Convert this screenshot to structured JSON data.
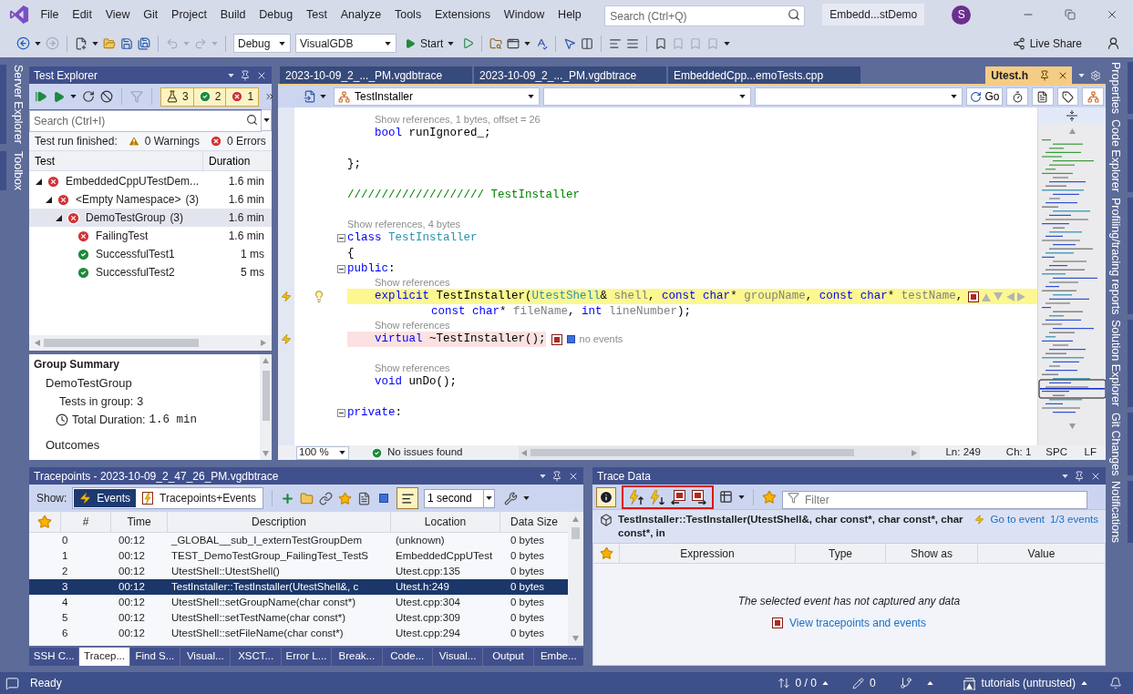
{
  "menu": {
    "items": [
      "File",
      "Edit",
      "View",
      "Git",
      "Project",
      "Build",
      "Debug",
      "Test",
      "Analyze",
      "Tools",
      "Extensions",
      "Window",
      "Help"
    ],
    "search": {
      "placeholder": "Search (Ctrl+Q)"
    },
    "solution": "Embedd...stDemo",
    "avatar": "S"
  },
  "toolbar": {
    "configuration": "Debug",
    "platform": "VisualGDB",
    "start": "Start",
    "live_share": "Live Share"
  },
  "left_dock": [
    {
      "label": "Server Explorer"
    },
    {
      "label": "Toolbox"
    }
  ],
  "right_dock": [
    {
      "label": "Properties"
    },
    {
      "label": "Code Explorer"
    },
    {
      "label": "Profiling/tracing reports"
    },
    {
      "label": "Solution Explorer"
    },
    {
      "label": "Git Changes"
    },
    {
      "label": "Notifications"
    }
  ],
  "test_explorer": {
    "title": "Test Explorer",
    "counters": [
      {
        "kind": "total",
        "count": "3"
      },
      {
        "kind": "passed",
        "count": "2"
      },
      {
        "kind": "failed",
        "count": "1"
      }
    ],
    "search": {
      "placeholder": "Search (Ctrl+I)"
    },
    "run_status": {
      "label": "Test run finished:",
      "warnings": "0 Warnings",
      "errors": "0 Errors"
    },
    "columns": [
      "Test",
      "Duration"
    ],
    "tree": [
      {
        "name": "EmbeddedCppUTestDem...",
        "kind": "failed",
        "duration": "1.6 min",
        "expanded": true,
        "selected": false,
        "children": [
          {
            "name": "<Empty Namespace>",
            "count": "(3)",
            "kind": "failed",
            "duration": "1.6 min",
            "expanded": true,
            "selected": false,
            "children": [
              {
                "name": "DemoTestGroup",
                "count": "(3)",
                "kind": "failed",
                "duration": "1.6 min",
                "expanded": true,
                "selected": true,
                "children": [
                  {
                    "name": "FailingTest",
                    "kind": "failed",
                    "duration": "1.6 min",
                    "selected": false
                  },
                  {
                    "name": "SuccessfulTest1",
                    "kind": "passed",
                    "duration": "1 ms",
                    "selected": false
                  },
                  {
                    "name": "SuccessfulTest2",
                    "kind": "passed",
                    "duration": "5 ms",
                    "selected": false
                  }
                ]
              }
            ]
          }
        ]
      }
    ],
    "group_summary": {
      "title": "Group Summary",
      "group": "DemoTestGroup",
      "tests_label": "Tests in group:",
      "tests_value": "3",
      "duration_label": "Total Duration:",
      "duration_value": "1.6 min",
      "outcomes_label": "Outcomes"
    }
  },
  "editor": {
    "tabs": [
      {
        "label": "2023-10-09_2_..._PM.vgdbtrace",
        "selected": false
      },
      {
        "label": "2023-10-09_2_..._PM.vgdbtrace",
        "selected": false
      },
      {
        "label": "EmbeddedCpp...emoTests.cpp",
        "selected": false
      },
      {
        "label": "Utest.h",
        "selected": true
      }
    ],
    "scope": "TestInstaller",
    "go": "Go",
    "lines": [
      {
        "kind": "block",
        "children": [
          {
            "kind": "lens",
            "text": "Show references, 1 bytes, offset = 26"
          },
          {
            "kind": "code",
            "tokens": [
              {
                "text": "bool",
                "kind": "keyword"
              },
              {
                "text": " runIgnored_;",
                "kind": "plain"
              }
            ]
          }
        ]
      },
      {
        "kind": "blank"
      },
      {
        "kind": "code",
        "tokens": [
          {
            "text": "};",
            "kind": "plain"
          }
        ]
      },
      {
        "kind": "blank"
      },
      {
        "kind": "code",
        "tokens": [
          {
            "text": "//////////////////// TestInstaller",
            "kind": "comment"
          }
        ]
      },
      {
        "kind": "blank"
      },
      {
        "kind": "lens",
        "text": "Show references, 4 bytes"
      },
      {
        "kind": "code",
        "expanded": true,
        "tokens": [
          {
            "text": "class",
            "kind": "keyword"
          },
          {
            "text": " TestInstaller",
            "kind": "type"
          }
        ]
      },
      {
        "kind": "code",
        "tokens": [
          {
            "text": "{",
            "kind": "plain"
          }
        ]
      },
      {
        "kind": "code",
        "expanded": true,
        "tokens": [
          {
            "text": "public",
            "kind": "keyword"
          },
          {
            "text": ":",
            "kind": "plain"
          }
        ],
        "children": [
          {
            "kind": "lens",
            "text": "Show references"
          },
          {
            "kind": "code",
            "current": true,
            "tracepoint": true,
            "quick_action": true,
            "adornment": {
              "kind": "navigation"
            },
            "tokens": [
              {
                "text": "explicit",
                "kind": "keyword"
              },
              {
                "text": " TestInstaller(",
                "kind": "plain"
              },
              {
                "text": "UtestShell",
                "kind": "type"
              },
              {
                "text": "& ",
                "kind": "plain"
              },
              {
                "text": "shell",
                "kind": "param"
              },
              {
                "text": ", ",
                "kind": "plain"
              },
              {
                "text": "const char",
                "kind": "keyword"
              },
              {
                "text": "* ",
                "kind": "plain"
              },
              {
                "text": "groupName",
                "kind": "param"
              },
              {
                "text": ", ",
                "kind": "plain"
              },
              {
                "text": "const char",
                "kind": "keyword"
              },
              {
                "text": "* ",
                "kind": "plain"
              },
              {
                "text": "testName",
                "kind": "param"
              },
              {
                "text": ",",
                "kind": "plain"
              }
            ],
            "children": [
              {
                "kind": "code",
                "tokens": [
                  {
                    "text": "const char",
                    "kind": "keyword"
                  },
                  {
                    "text": "* ",
                    "kind": "plain"
                  },
                  {
                    "text": "fileName",
                    "kind": "param"
                  },
                  {
                    "text": ", ",
                    "kind": "plain"
                  },
                  {
                    "text": "int ",
                    "kind": "keyword"
                  },
                  {
                    "text": "lineNumber",
                    "kind": "param"
                  },
                  {
                    "text": ");",
                    "kind": "plain"
                  }
                ]
              }
            ]
          },
          {
            "kind": "lens",
            "text": "Show references"
          },
          {
            "kind": "code",
            "current": false,
            "tracepoint": true,
            "adornment": {
              "kind": "status",
              "text": "no events"
            },
            "tokens": [
              {
                "text": "virtual",
                "kind": "keyword"
              },
              {
                "text": " ~TestInstaller();",
                "kind": "plain"
              }
            ]
          },
          {
            "kind": "blank"
          },
          {
            "kind": "lens",
            "text": "Show references"
          },
          {
            "kind": "code",
            "tokens": [
              {
                "text": "void",
                "kind": "keyword"
              },
              {
                "text": " unDo();",
                "kind": "plain"
              }
            ]
          },
          {
            "kind": "blank"
          }
        ]
      },
      {
        "kind": "code",
        "expanded": true,
        "tokens": [
          {
            "text": "private",
            "kind": "keyword"
          },
          {
            "text": ":",
            "kind": "plain"
          }
        ]
      },
      {
        "kind": "blank"
      }
    ],
    "status": {
      "zoom": "100 %",
      "issues": "No issues found",
      "line": "Ln: 249",
      "column": "Ch: 1",
      "whitespace": "SPC",
      "line_ending": "LF"
    }
  },
  "tracepoints": {
    "title": "Tracepoints - 2023-10-09_2_47_26_PM.vgdbtrace",
    "show_label": "Show:",
    "modes": [
      {
        "label": "Events",
        "selected": true
      },
      {
        "label": "Tracepoints+Events",
        "selected": false
      }
    ],
    "interval": "1 second",
    "columns": [
      "#",
      "Time",
      "Description",
      "Location",
      "Data Size"
    ],
    "rows": [
      {
        "index": "0",
        "time": "00:12",
        "description": "_GLOBAL__sub_I_externTestGroupDem",
        "location": "(unknown)",
        "size": "0 bytes",
        "selected": false
      },
      {
        "index": "1",
        "time": "00:12",
        "description": "TEST_DemoTestGroup_FailingTest_TestS",
        "location": "EmbeddedCppUTest",
        "size": "0 bytes",
        "selected": false
      },
      {
        "index": "2",
        "time": "00:12",
        "description": "UtestShell::UtestShell()",
        "location": "Utest.cpp:135",
        "size": "0 bytes",
        "selected": false
      },
      {
        "index": "3",
        "time": "00:12",
        "description": "TestInstaller::TestInstaller(UtestShell&, c",
        "location": "Utest.h:249",
        "size": "0 bytes",
        "selected": true
      },
      {
        "index": "4",
        "time": "00:12",
        "description": "UtestShell::setGroupName(char const*)",
        "location": "Utest.cpp:304",
        "size": "0 bytes",
        "selected": false
      },
      {
        "index": "5",
        "time": "00:12",
        "description": "UtestShell::setTestName(char const*)",
        "location": "Utest.cpp:309",
        "size": "0 bytes",
        "selected": false
      },
      {
        "index": "6",
        "time": "00:12",
        "description": "UtestShell::setFileName(char const*)",
        "location": "Utest.cpp:294",
        "size": "0 bytes",
        "selected": false
      }
    ],
    "tabs": [
      {
        "label": "SSH C...",
        "selected": false
      },
      {
        "label": "Tracep...",
        "selected": true
      },
      {
        "label": "Find S...",
        "selected": false
      },
      {
        "label": "Visual...",
        "selected": false
      },
      {
        "label": "XSCT...",
        "selected": false
      },
      {
        "label": "Error L...",
        "selected": false
      },
      {
        "label": "Break...",
        "selected": false
      },
      {
        "label": "Code...",
        "selected": false
      },
      {
        "label": "Visual...",
        "selected": false
      },
      {
        "label": "Output",
        "selected": false
      },
      {
        "label": "Embe...",
        "selected": false
      }
    ]
  },
  "trace_data": {
    "title": "Trace Data",
    "filter": {
      "placeholder": "Filter"
    },
    "event": "TestInstaller::TestInstaller(UtestShell&, char const*, char const*, char const*, in",
    "links": [
      "Go to event",
      "1/3 events"
    ],
    "columns": [
      "Expression",
      "Type",
      "Show as",
      "Value"
    ],
    "empty_message": "The selected event has not captured any data",
    "view_link": "View tracepoints and events"
  },
  "status_bar": {
    "text": "Ready",
    "changes": "0 / 0",
    "edits": "0",
    "repository": "tutorials (untrusted)"
  }
}
